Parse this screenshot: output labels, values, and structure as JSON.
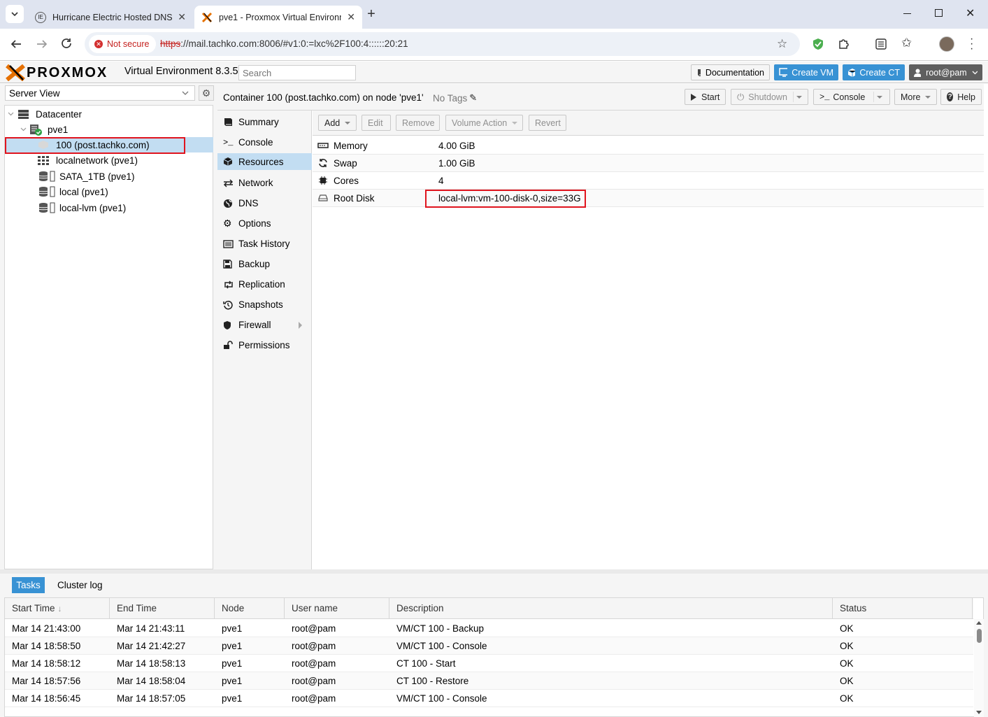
{
  "browser": {
    "tabs": [
      {
        "title": "Hurricane Electric Hosted DNS",
        "active": false
      },
      {
        "title": "pve1 - Proxmox Virtual Environm",
        "active": true
      }
    ],
    "security_label": "Not secure",
    "url_scheme": "https",
    "url_rest": "://mail.tachko.com:8006/#v1:0:=lxc%2F100:4::::::20:21"
  },
  "header": {
    "logo_text": "PROXMOX",
    "product": "Virtual Environment 8.3.5",
    "search_placeholder": "Search",
    "documentation": "Documentation",
    "create_vm": "Create VM",
    "create_ct": "Create CT",
    "user": "root@pam"
  },
  "sidebar": {
    "view": "Server View",
    "tree": [
      {
        "label": "Datacenter",
        "icon": "server-rack-icon"
      },
      {
        "label": "pve1",
        "icon": "node-online-icon"
      },
      {
        "label": "100 (post.tachko.com)",
        "icon": "container-icon",
        "selected": true
      },
      {
        "label": "localnetwork (pve1)",
        "icon": "network-grid-icon"
      },
      {
        "label": "SATA_1TB (pve1)",
        "icon": "storage-icon"
      },
      {
        "label": "local (pve1)",
        "icon": "storage-icon"
      },
      {
        "label": "local-lvm (pve1)",
        "icon": "storage-icon"
      }
    ]
  },
  "content": {
    "title": "Container 100 (post.tachko.com) on node 'pve1'",
    "tags": "No Tags",
    "actions": {
      "start": "Start",
      "shutdown": "Shutdown",
      "console": "Console",
      "more": "More",
      "help": "Help"
    },
    "menu": [
      {
        "label": "Summary",
        "icon": "book-icon"
      },
      {
        "label": "Console",
        "icon": "terminal-icon"
      },
      {
        "label": "Resources",
        "icon": "cube-icon",
        "selected": true
      },
      {
        "label": "Network",
        "icon": "exchange-icon"
      },
      {
        "label": "DNS",
        "icon": "globe-icon"
      },
      {
        "label": "Options",
        "icon": "gear-icon"
      },
      {
        "label": "Task History",
        "icon": "list-icon"
      },
      {
        "label": "Backup",
        "icon": "floppy-icon"
      },
      {
        "label": "Replication",
        "icon": "retweet-icon"
      },
      {
        "label": "Snapshots",
        "icon": "history-icon"
      },
      {
        "label": "Firewall",
        "icon": "shield-icon"
      },
      {
        "label": "Permissions",
        "icon": "unlock-icon"
      }
    ],
    "resource_toolbar": {
      "add": "Add",
      "edit": "Edit",
      "remove": "Remove",
      "volume_action": "Volume Action",
      "revert": "Revert"
    },
    "resources": [
      {
        "key": "Memory",
        "value": "4.00 GiB",
        "icon": "memory-icon"
      },
      {
        "key": "Swap",
        "value": "1.00 GiB",
        "icon": "refresh-icon"
      },
      {
        "key": "Cores",
        "value": "4",
        "icon": "cpu-icon"
      },
      {
        "key": "Root Disk",
        "value": "local-lvm:vm-100-disk-0,size=33G",
        "icon": "hdd-icon"
      }
    ]
  },
  "tasks": {
    "tabs": [
      "Tasks",
      "Cluster log"
    ],
    "columns": [
      "Start Time",
      "End Time",
      "Node",
      "User name",
      "Description",
      "Status"
    ],
    "rows": [
      [
        "Mar 14 21:43:00",
        "Mar 14 21:43:11",
        "pve1",
        "root@pam",
        "VM/CT 100 - Backup",
        "OK"
      ],
      [
        "Mar 14 18:58:50",
        "Mar 14 21:42:27",
        "pve1",
        "root@pam",
        "VM/CT 100 - Console",
        "OK"
      ],
      [
        "Mar 14 18:58:12",
        "Mar 14 18:58:13",
        "pve1",
        "root@pam",
        "CT 100 - Start",
        "OK"
      ],
      [
        "Mar 14 18:57:56",
        "Mar 14 18:58:04",
        "pve1",
        "root@pam",
        "CT 100 - Restore",
        "OK"
      ],
      [
        "Mar 14 18:56:45",
        "Mar 14 18:57:05",
        "pve1",
        "root@pam",
        "VM/CT 100 - Console",
        "OK"
      ]
    ]
  },
  "colors": {
    "accent": "#3892d4",
    "selection": "#c2ddf2",
    "highlight_box": "#e0141e",
    "proxmox_orange": "#e57000",
    "user_button": "#5f5f5f"
  }
}
